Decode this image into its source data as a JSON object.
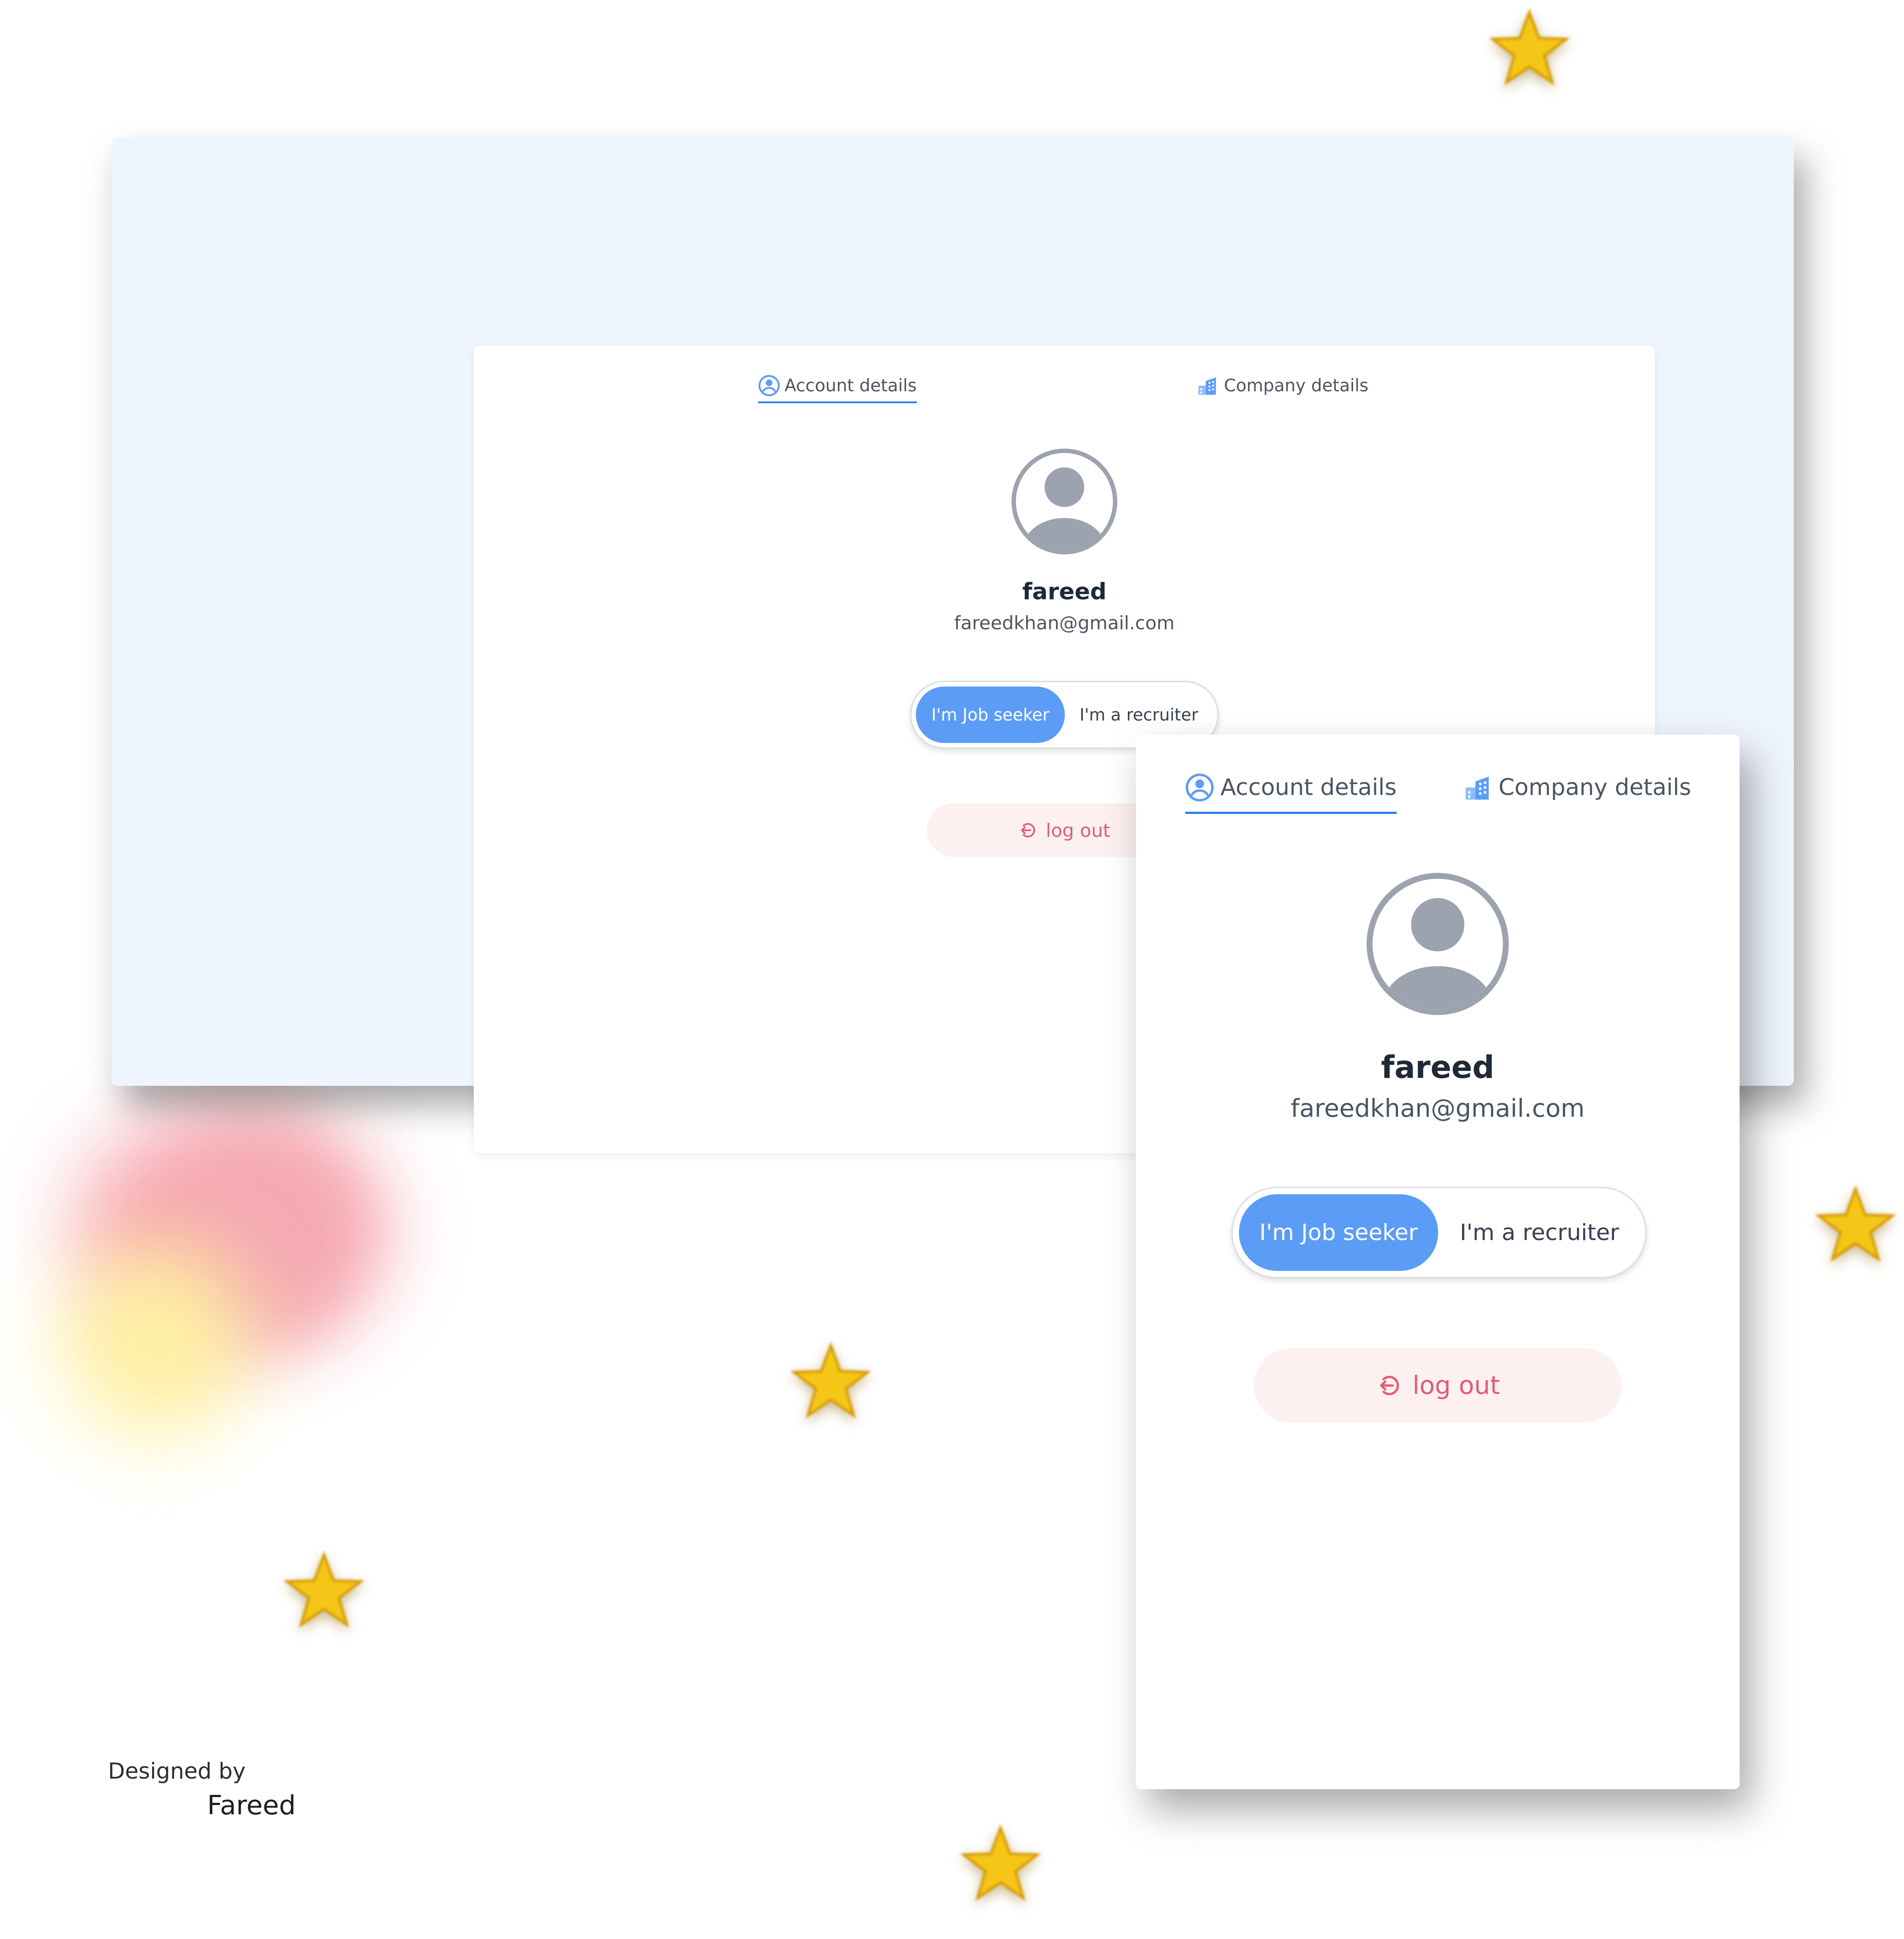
{
  "colors": {
    "accent": "#5b9cf7",
    "danger": "#e05d6f",
    "danger_bg": "#fdf0f1",
    "panel_bg": "#eff5fe",
    "star": "#f5c518"
  },
  "desktop_view": {
    "tabs": [
      {
        "label": "Account details",
        "icon": "user-circle-icon",
        "active": true
      },
      {
        "label": "Company details",
        "icon": "building-icon",
        "active": false
      }
    ],
    "user": {
      "name": "fareed",
      "email": "fareedkhan@gmail.com"
    },
    "role_toggle": {
      "options": [
        "I'm Job seeker",
        "I'm a recruiter"
      ],
      "selected": "I'm Job seeker"
    },
    "logout_label": "log out"
  },
  "mobile_view": {
    "tabs": [
      {
        "label": "Account details",
        "icon": "user-circle-icon",
        "active": true
      },
      {
        "label": "Company details",
        "icon": "building-icon",
        "active": false
      }
    ],
    "user": {
      "name": "fareed",
      "email": "fareedkhan@gmail.com"
    },
    "role_toggle": {
      "options": [
        "I'm Job seeker",
        "I'm a recruiter"
      ],
      "selected": "I'm Job seeker"
    },
    "logout_label": "log out"
  },
  "credit": {
    "line1": "Designed by",
    "line2": "Fareed"
  }
}
